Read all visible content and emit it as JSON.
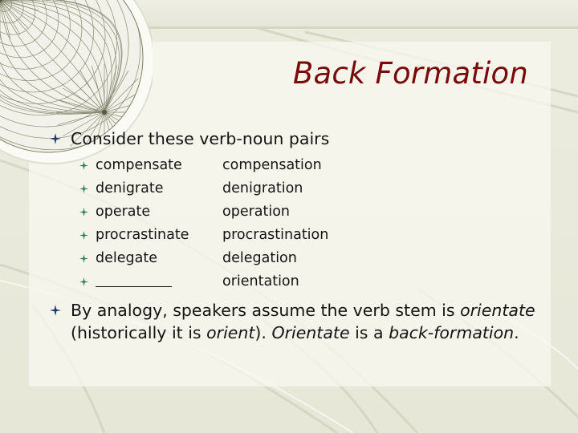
{
  "slide": {
    "title": "Back Formation",
    "colors": {
      "title": "#7a0a0a",
      "bullet_level1": "#1d3b66",
      "bullet_level2": "#2e7d5b",
      "text": "#141414",
      "background": "#e9e9dc"
    },
    "bullet_icon": "four-point-star",
    "bullets": [
      {
        "text": "Consider these verb-noun pairs",
        "pairs": [
          {
            "verb": "compensate",
            "noun": "compensation"
          },
          {
            "verb": "denigrate",
            "noun": "denigration"
          },
          {
            "verb": "operate",
            "noun": "operation"
          },
          {
            "verb": "procrastinate",
            "noun": "procrastination"
          },
          {
            "verb": "delegate",
            "noun": "delegation"
          },
          {
            "verb": "",
            "noun": "orientation",
            "verb_is_blank": true
          }
        ]
      },
      {
        "segments": [
          {
            "text": "By analogy, speakers assume the verb stem is ",
            "italic": false
          },
          {
            "text": "orientate",
            "italic": true
          },
          {
            "text": " (historically it is ",
            "italic": false
          },
          {
            "text": "orient",
            "italic": true
          },
          {
            "text": ").  ",
            "italic": false
          },
          {
            "text": "Orientate",
            "italic": true
          },
          {
            "text": " is a ",
            "italic": false
          },
          {
            "text": "back-formation",
            "italic": true
          },
          {
            "text": ".",
            "italic": false
          }
        ]
      }
    ]
  }
}
